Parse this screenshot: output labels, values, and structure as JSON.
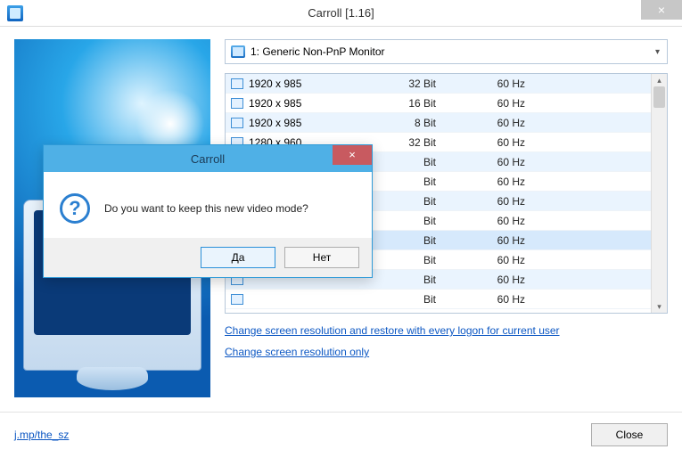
{
  "window": {
    "title": "Carroll [1.16]",
    "close_glyph": "×"
  },
  "monitor_select": {
    "selected": "1: Generic Non-PnP Monitor"
  },
  "resolutions": [
    {
      "res": "1920 x 985",
      "bit": "32 Bit",
      "hz": "60 Hz"
    },
    {
      "res": "1920 x 985",
      "bit": "16 Bit",
      "hz": "60 Hz"
    },
    {
      "res": "1920 x 985",
      "bit": "8 Bit",
      "hz": "60 Hz"
    },
    {
      "res": "1280 x 960",
      "bit": "32 Bit",
      "hz": "60 Hz"
    },
    {
      "res": "",
      "bit": "Bit",
      "hz": "60 Hz"
    },
    {
      "res": "",
      "bit": "Bit",
      "hz": "60 Hz"
    },
    {
      "res": "",
      "bit": "Bit",
      "hz": "60 Hz"
    },
    {
      "res": "",
      "bit": "Bit",
      "hz": "60 Hz"
    },
    {
      "res": "",
      "bit": "Bit",
      "hz": "60 Hz"
    },
    {
      "res": "",
      "bit": "Bit",
      "hz": "60 Hz"
    },
    {
      "res": "",
      "bit": "Bit",
      "hz": "60 Hz"
    },
    {
      "res": "",
      "bit": "Bit",
      "hz": "60 Hz"
    }
  ],
  "selected_row_index": 8,
  "links": {
    "link1": "Change screen resolution and restore with every logon for current user",
    "link2": "Change screen resolution only"
  },
  "footer": {
    "site_link": "j.mp/the_sz",
    "close_label": "Close"
  },
  "dialog": {
    "title": "Carroll",
    "close_glyph": "×",
    "question_glyph": "?",
    "message": "Do you want to keep this new video mode?",
    "yes_label": "Да",
    "no_label": "Нет"
  }
}
